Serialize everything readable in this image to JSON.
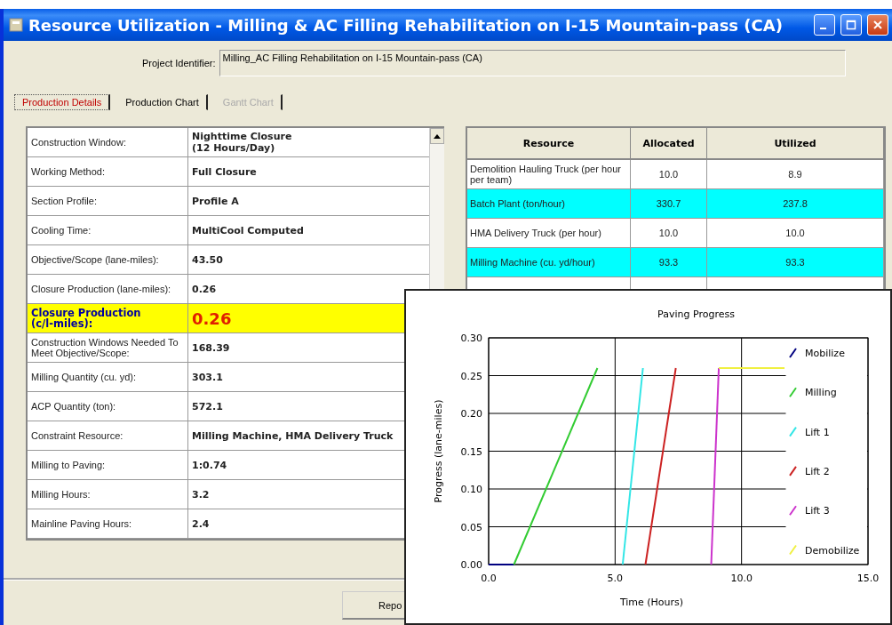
{
  "window": {
    "title": "Resource Utilization - Milling & AC Filling Rehabilitation on I-15 Mountain-pass (CA)"
  },
  "project": {
    "label": "Project Identifier:",
    "value": "Milling_AC Filling Rehabilitation on I-15 Mountain-pass (CA)"
  },
  "tabs": [
    {
      "label": "Production Details",
      "selected": true,
      "disabled": false
    },
    {
      "label": "Production Chart",
      "selected": false,
      "disabled": false
    },
    {
      "label": "Gantt Chart",
      "selected": false,
      "disabled": true
    }
  ],
  "details": [
    {
      "label": "Construction Window:",
      "value": "Nighttime Closure\n(12 Hours/Day)",
      "highlighted": false
    },
    {
      "label": "Working Method:",
      "value": "Full Closure",
      "highlighted": false
    },
    {
      "label": "Section Profile:",
      "value": "Profile A",
      "highlighted": false
    },
    {
      "label": "Cooling Time:",
      "value": "MultiCool Computed",
      "highlighted": false
    },
    {
      "label": "Objective/Scope (lane-miles):",
      "value": "43.50",
      "highlighted": false
    },
    {
      "label": "Closure Production (lane-miles):",
      "value": "0.26",
      "highlighted": false
    },
    {
      "label": "Closure Production\n(c/l-miles):",
      "value": "0.26",
      "highlighted": true
    },
    {
      "label": "Construction Windows Needed To Meet Objective/Scope:",
      "value": "168.39",
      "highlighted": false
    },
    {
      "label": "Milling Quantity (cu. yd):",
      "value": "303.1",
      "highlighted": false
    },
    {
      "label": "ACP Quantity (ton):",
      "value": "572.1",
      "highlighted": false
    },
    {
      "label": "Constraint Resource:",
      "value": "Milling Machine, HMA Delivery Truck",
      "highlighted": false
    },
    {
      "label": "Milling to Paving:",
      "value": "1:0.74",
      "highlighted": false
    },
    {
      "label": "Milling Hours:",
      "value": "3.2",
      "highlighted": false
    },
    {
      "label": "Mainline Paving Hours:",
      "value": "2.4",
      "highlighted": false
    }
  ],
  "resources": {
    "columns": [
      "Resource",
      "Allocated",
      "Utilized"
    ],
    "rows": [
      {
        "resource": "Demolition Hauling Truck (per hour per team)",
        "allocated": "10.0",
        "utilized": "8.9",
        "highlighted": false
      },
      {
        "resource": "Batch Plant (ton/hour)",
        "allocated": "330.7",
        "utilized": "237.8",
        "highlighted": true
      },
      {
        "resource": "HMA Delivery Truck (per hour)",
        "allocated": "10.0",
        "utilized": "10.0",
        "highlighted": false
      },
      {
        "resource": "Milling Machine (cu. yd/hour)",
        "allocated": "93.3",
        "utilized": "93.3",
        "highlighted": true
      }
    ]
  },
  "report_button": {
    "label": "Repo"
  },
  "chart_popup": {
    "chart_data": {
      "type": "line",
      "title": "Paving Progress",
      "xlabel": "Time (Hours)",
      "ylabel": "Progress (lane-miles)",
      "x": [
        0,
        1,
        4.3,
        5.3,
        6.1,
        6.2,
        7.4,
        8.8,
        9.1,
        11.7
      ],
      "series": [
        {
          "name": "Mobilize",
          "color": "#000080",
          "values": [
            0,
            0,
            null,
            null,
            null,
            null,
            null,
            null,
            null,
            null
          ]
        },
        {
          "name": "Milling",
          "color": "#33cc33",
          "values": [
            null,
            0,
            0.26,
            null,
            null,
            null,
            null,
            null,
            null,
            null
          ]
        },
        {
          "name": "Lift 1",
          "color": "#33e6e6",
          "values": [
            null,
            null,
            null,
            0,
            0.26,
            null,
            null,
            null,
            null,
            null
          ]
        },
        {
          "name": "Lift 2",
          "color": "#cc2222",
          "values": [
            null,
            null,
            null,
            null,
            null,
            0,
            0.26,
            null,
            null,
            null
          ]
        },
        {
          "name": "Lift 3",
          "color": "#cc33cc",
          "values": [
            null,
            null,
            null,
            null,
            null,
            null,
            null,
            0,
            0.26,
            null
          ]
        },
        {
          "name": "Demobilize",
          "color": "#f0f040",
          "values": [
            null,
            null,
            null,
            null,
            null,
            null,
            null,
            null,
            0.26,
            0.26
          ]
        }
      ],
      "grid": true,
      "legend": true,
      "xlim": [
        0,
        15
      ],
      "ylim": [
        0,
        0.3
      ],
      "xticks": [
        {
          "value": 0,
          "label": "0.0"
        },
        {
          "value": 5,
          "label": "5.0"
        },
        {
          "value": 10,
          "label": "10.0"
        },
        {
          "value": 15,
          "label": "15.0"
        }
      ],
      "yticks": [
        {
          "value": 0,
          "label": "0.00"
        },
        {
          "value": 0.05,
          "label": "0.05"
        },
        {
          "value": 0.1,
          "label": "0.10"
        },
        {
          "value": 0.15,
          "label": "0.15"
        },
        {
          "value": 0.2,
          "label": "0.20"
        },
        {
          "value": 0.25,
          "label": "0.25"
        },
        {
          "value": 0.3,
          "label": "0.30"
        }
      ]
    }
  }
}
